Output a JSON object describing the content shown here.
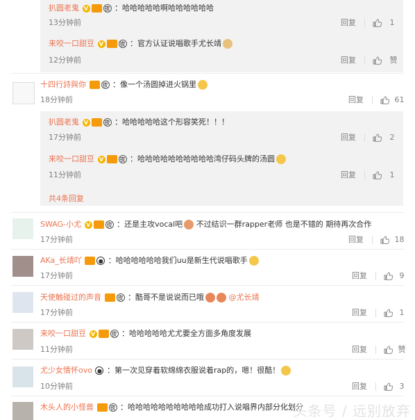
{
  "labels": {
    "reply": "回复",
    "like": "赞"
  },
  "thread1": {
    "replies": [
      {
        "name": "扒圆老鬼",
        "text": "：哈哈哈哈哈啊哈哈哈哈哈哈",
        "time": "13分钟前",
        "likes": "1"
      },
      {
        "name": "来咬一口甜豆",
        "text": "：官方认证说唱歌手尤长靖",
        "time": "12分钟前",
        "likes": "赞"
      }
    ]
  },
  "thread2": {
    "name": "十四行詩與你",
    "text": "：像一个汤圆掉进火锅里",
    "time": "18分钟前",
    "likes": "61",
    "replies": [
      {
        "name": "扒圆老鬼",
        "text": "：哈哈哈哈哈这个形容笑死！！！",
        "time": "17分钟前",
        "likes": "2"
      },
      {
        "name": "来咬一口甜豆",
        "text": "：哈哈哈哈哈哈哈哈哈哈湾仔码头牌的汤圆",
        "time": "11分钟前",
        "likes": "1"
      }
    ],
    "more": "共4条回复"
  },
  "comments": [
    {
      "name": "SWAG-小尤",
      "text": "：还是主攻vocal吧",
      "text2": "不过结识一群rapper老师 也是不错的 期待再次合作",
      "time": "17分钟前",
      "likes": "18"
    },
    {
      "name": "AKa_长靖吖",
      "text": "：哈哈哈哈哈哈我们uu是新生代说唱歌手",
      "time": "17分钟前",
      "likes": "9"
    },
    {
      "name": "天使触碰过的声音",
      "text": "：酷哥不是说说而已哦",
      "mention": "@尤长靖",
      "time": "17分钟前",
      "likes": "1"
    },
    {
      "name": "来咬一口甜豆",
      "text": "：哈哈哈哈哈尤尤要全方面多角度发展",
      "time": "11分钟前",
      "likes": "赞"
    },
    {
      "name": "尤少女情怀ovo",
      "text": "：第一次见穿着软绵绵衣服说着rap的，嗯！很酷！",
      "time": "10分钟前",
      "likes": "3"
    },
    {
      "name": "木头人的小怪兽",
      "text": "：哈哈哈哈哈哈哈哈哈哈成功打入说唱界内部分化划分",
      "time": "",
      "likes": ""
    }
  ],
  "watermark": "头条号 / 远别放弃"
}
